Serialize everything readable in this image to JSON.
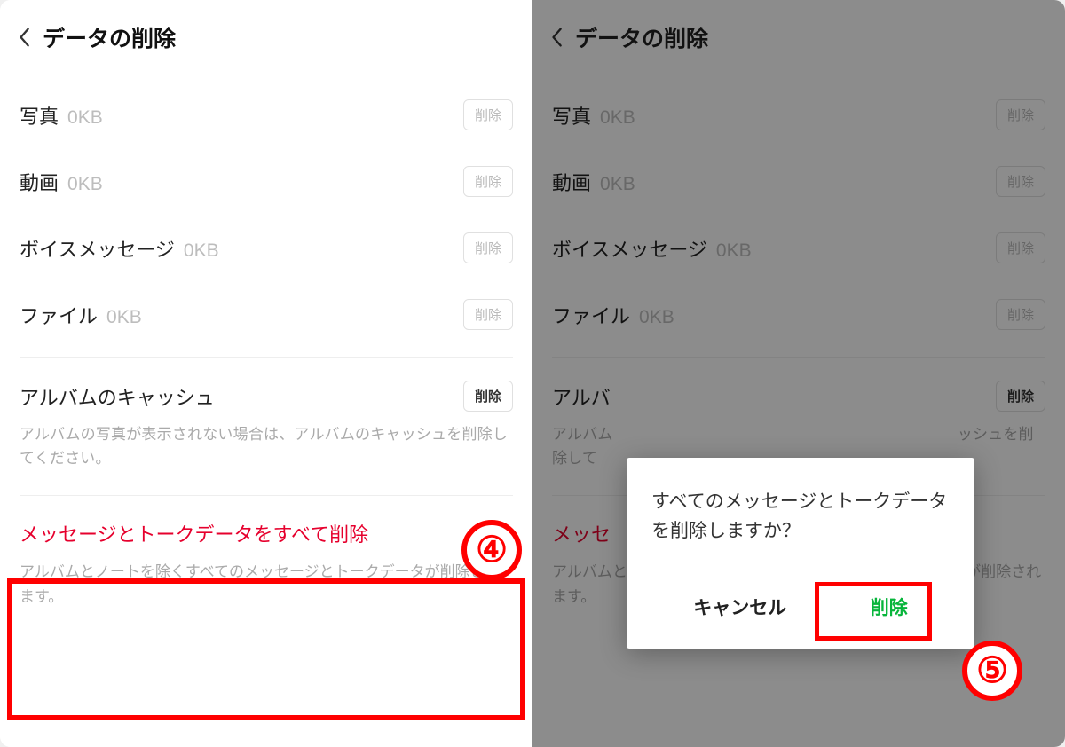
{
  "header": {
    "title": "データの削除"
  },
  "items": [
    {
      "label": "写真",
      "size": "0KB",
      "btn": "削除"
    },
    {
      "label": "動画",
      "size": "0KB",
      "btn": "削除"
    },
    {
      "label": "ボイスメッセージ",
      "size": "0KB",
      "btn": "削除"
    },
    {
      "label": "ファイル",
      "size": "0KB",
      "btn": "削除"
    }
  ],
  "albumCache": {
    "title": "アルバムのキャッシュ",
    "btn": "削除",
    "desc": "アルバムの写真が表示されない場合は、アルバムのキャッシュを削除してください。"
  },
  "danger": {
    "title": "メッセージとトークデータをすべて削除",
    "desc": "アルバムとノートを除くすべてのメッセージとトークデータが削除されます。"
  },
  "dialog": {
    "msg": "すべてのメッセージとトークデータを削除しますか？",
    "cancel": "キャンセル",
    "delete": "削除"
  },
  "markers": {
    "four": "④",
    "five": "⑤"
  },
  "right_danger_title_visible": "メッセ",
  "right_danger_desc_visible_1": "アルバムとノートを除くすべてのメッセージとト",
  "right_danger_desc_visible_2": "が削除されます。",
  "right_album_desc_visible_1": "アルバム",
  "right_album_desc_visible_2": "ッシュを削除して",
  "right_album_title_visible": "アルバ"
}
